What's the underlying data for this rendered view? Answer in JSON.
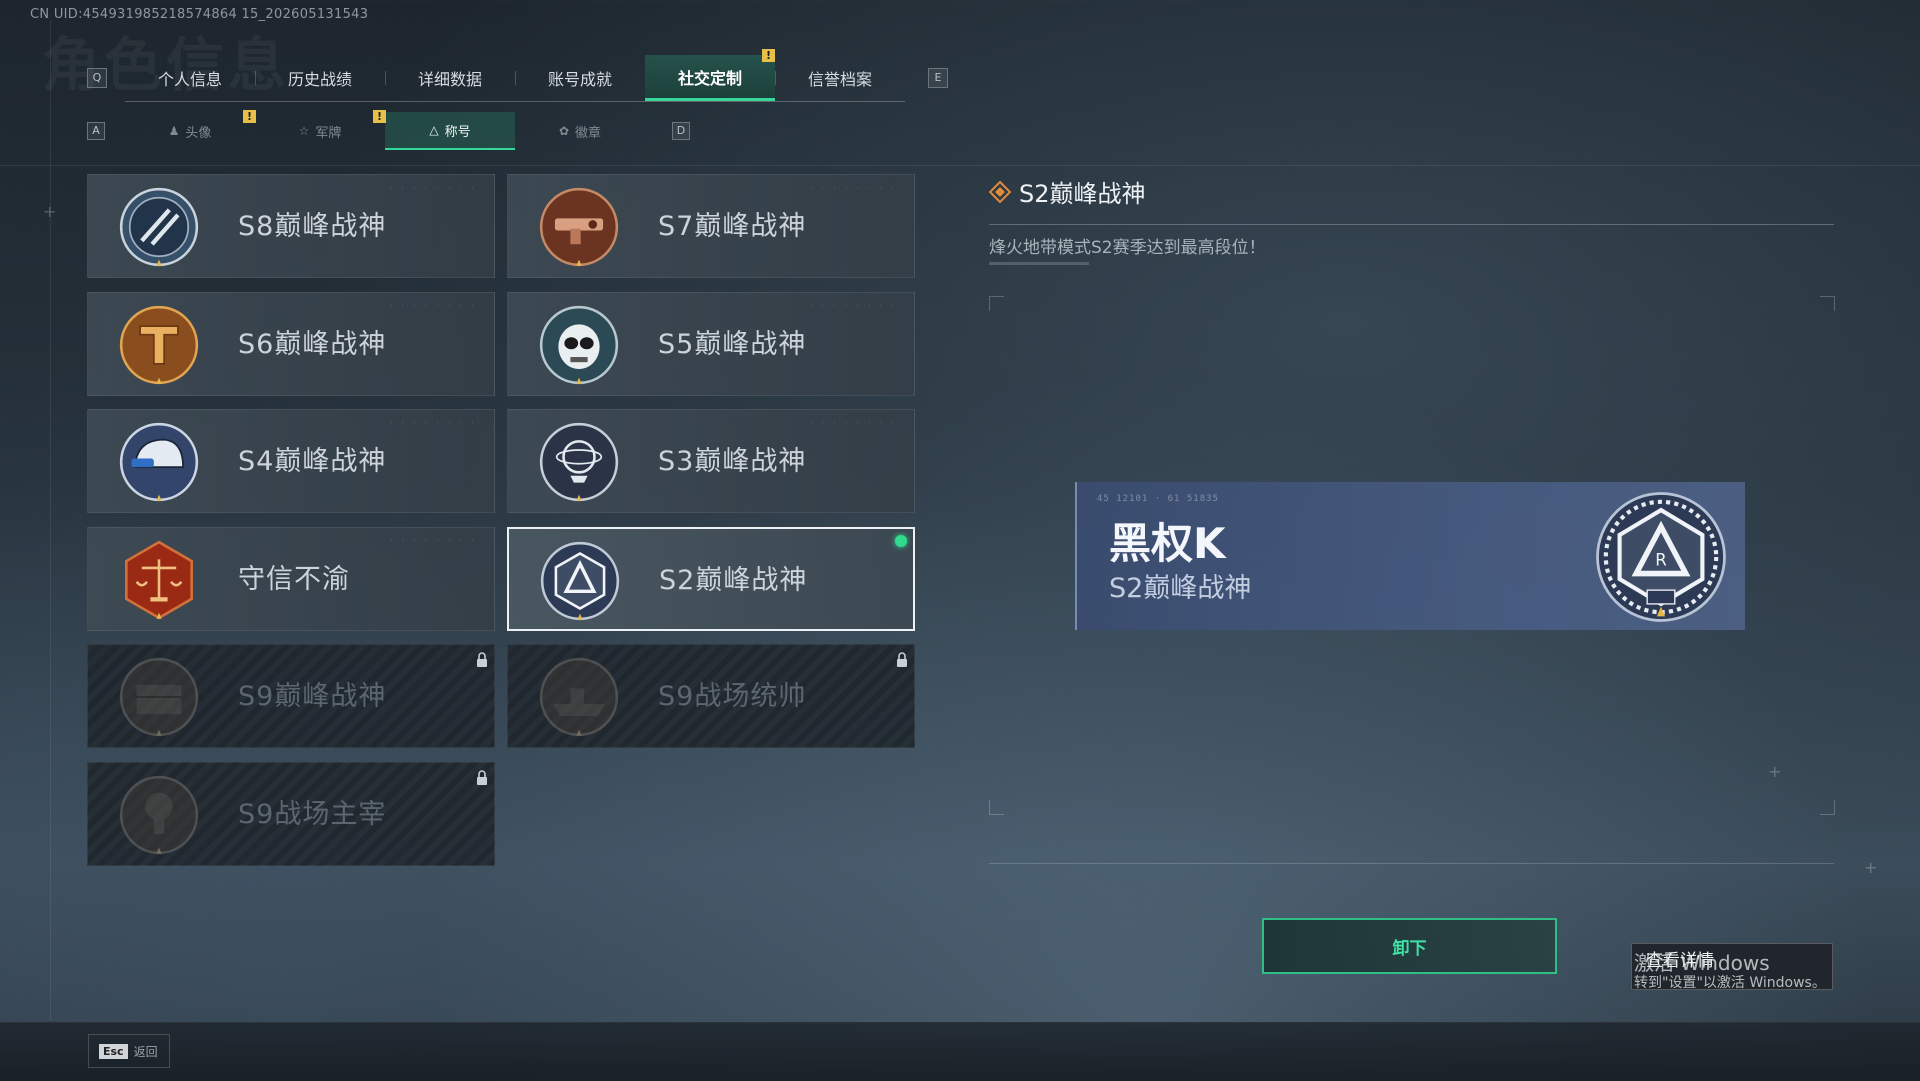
{
  "uid_text": "CN UID:454931985218574864 15_202605131543",
  "background_title": "角色信息",
  "tabs": {
    "prev_key": "Q",
    "next_key": "E",
    "items": [
      "个人信息",
      "历史战绩",
      "详细数据",
      "账号成就",
      "社交定制",
      "信誉档案"
    ],
    "active": "社交定制"
  },
  "subtabs": {
    "prev_key": "A",
    "next_key": "D",
    "items": [
      "头像",
      "军牌",
      "称号",
      "徽章"
    ],
    "active": "称号"
  },
  "alert_symbol": "!",
  "cards": [
    {
      "label": "S8巅峰战神",
      "emblem": "s8-emblem",
      "locked": false,
      "selected": false
    },
    {
      "label": "S7巅峰战神",
      "emblem": "s7-emblem",
      "locked": false,
      "selected": false
    },
    {
      "label": "S6巅峰战神",
      "emblem": "s6-emblem",
      "locked": false,
      "selected": false
    },
    {
      "label": "S5巅峰战神",
      "emblem": "s5-emblem",
      "locked": false,
      "selected": false
    },
    {
      "label": "S4巅峰战神",
      "emblem": "s4-emblem",
      "locked": false,
      "selected": false
    },
    {
      "label": "S3巅峰战神",
      "emblem": "s3-emblem",
      "locked": false,
      "selected": false
    },
    {
      "label": "守信不渝",
      "emblem": "scales-emblem",
      "locked": false,
      "selected": false
    },
    {
      "label": "S2巅峰战神",
      "emblem": "s2-emblem",
      "locked": false,
      "selected": true
    },
    {
      "label": "S9巅峰战神",
      "emblem": "s9-wall-emblem",
      "locked": true,
      "selected": false
    },
    {
      "label": "S9战场统帅",
      "emblem": "s9-ship-emblem",
      "locked": true,
      "selected": false
    },
    {
      "label": "S9战场主宰",
      "emblem": "s9-blast-emblem",
      "locked": true,
      "selected": false
    }
  ],
  "detail": {
    "title": "S2巅峰战神",
    "description": "烽火地带模式S2赛季达到最高段位！"
  },
  "preview": {
    "player_name": "黑权K",
    "title": "S2巅峰战神"
  },
  "buttons": {
    "unequip": "卸下",
    "view_details": "查看详情"
  },
  "watermark": {
    "line1": "激活 Windows",
    "line2": "转到\"设置\"以激活 Windows。"
  },
  "footer": {
    "esc_key": "Esc",
    "back_label": "返回"
  },
  "colors": {
    "accent_green": "#37d69b",
    "selected_dot": "#2fdc8e",
    "alert_yellow": "#e7c04a",
    "preview_blue": "#4a5c84"
  }
}
